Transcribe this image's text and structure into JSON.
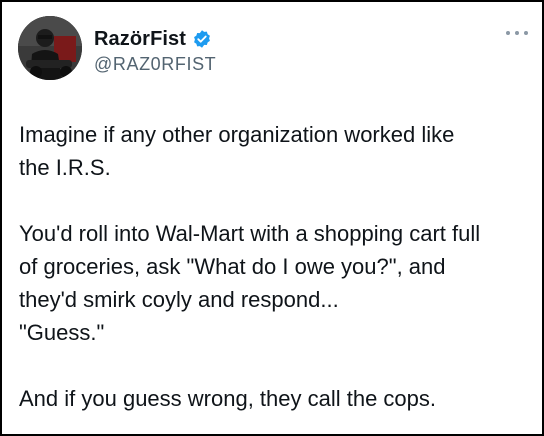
{
  "author": {
    "display_name": "RazörFist",
    "handle": "@RAZ0RFIST",
    "avatar_icon": "profile-photo",
    "verified_icon": "verified-badge-icon",
    "verified_color": "#1d9bf0"
  },
  "menu": {
    "icon": "more-options-icon"
  },
  "tweet": {
    "lines": [
      "Imagine if any other organization worked like",
      "the I.R.S.",
      "",
      "You'd roll into Wal-Mart with a shopping cart full",
      "of groceries, ask \"What do I owe you?\", and",
      "they'd smirk coyly and respond...",
      "\"Guess.\"",
      "",
      "And if you guess wrong, they call the cops."
    ]
  }
}
